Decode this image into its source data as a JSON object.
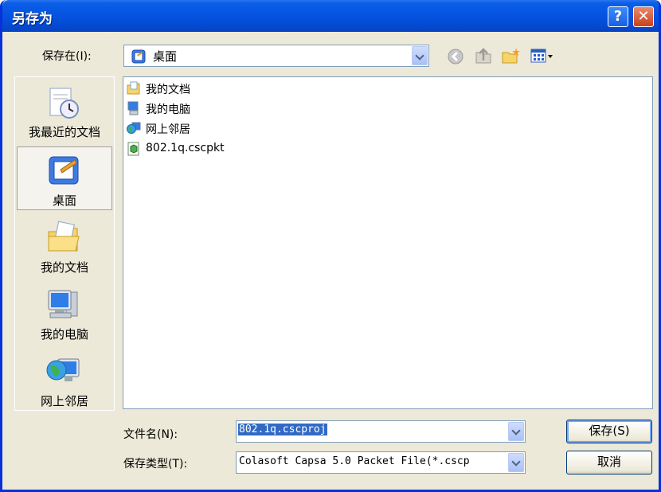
{
  "window": {
    "title": "另存为"
  },
  "title_buttons": {
    "help": "?",
    "close": "✕"
  },
  "look_in": {
    "label": "保存在(I):",
    "value": "桌面"
  },
  "toolbar": {
    "icons": [
      "back-icon",
      "up-folder-icon",
      "new-folder-icon",
      "views-menu-icon"
    ]
  },
  "places": [
    {
      "label": "我最近的文档",
      "icon": "recent-documents-icon"
    },
    {
      "label": "桌面",
      "icon": "desktop-icon"
    },
    {
      "label": "我的文档",
      "icon": "my-documents-icon"
    },
    {
      "label": "我的电脑",
      "icon": "my-computer-icon"
    },
    {
      "label": "网上邻居",
      "icon": "network-places-icon"
    }
  ],
  "files": [
    {
      "name": "我的文档",
      "icon": "my-documents-icon"
    },
    {
      "name": "我的电脑",
      "icon": "my-computer-icon"
    },
    {
      "name": "网上邻居",
      "icon": "network-places-icon"
    },
    {
      "name": "802.1q.cscpkt",
      "icon": "packet-file-icon"
    }
  ],
  "filename": {
    "label": "文件名(N):",
    "value": "802.1q.cscproj"
  },
  "filetype": {
    "label": "保存类型(T):",
    "value": "Colasoft Capsa 5.0 Packet File(*.cscp"
  },
  "buttons": {
    "save": "保存(S)",
    "cancel": "取消"
  },
  "colors": {
    "title_blue": "#0553e0",
    "dialog_bg": "#ece9d8",
    "selection": "#316ac5"
  }
}
